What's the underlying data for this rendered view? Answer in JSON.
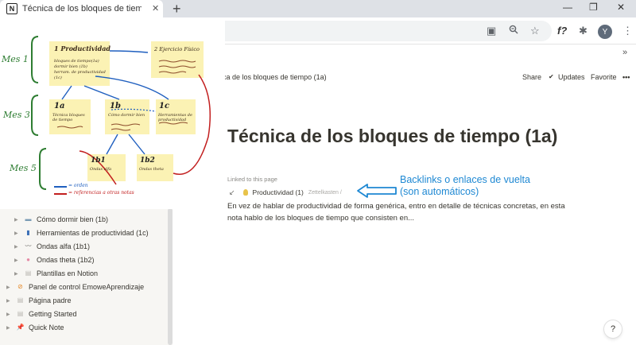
{
  "browser": {
    "tab_favicon": "N",
    "tab_title": "Técnica de los bloques de tiempo (1a)",
    "tab_close_icon": "close-icon",
    "new_tab": "+",
    "window_min": "—",
    "window_max": "❐",
    "window_close": "✕",
    "toolbar_icons": {
      "translate": "▣",
      "zoom": "🔍",
      "star": "☆",
      "functions": "f?",
      "extensions": "✱",
      "menu": "⋮"
    },
    "profile_initial": "Y",
    "bookmarks_more": "»"
  },
  "notion": {
    "breadcrumb": "ca de los bloques de tiempo (1a)",
    "share": "Share",
    "updates": "Updates",
    "favorite": "Favorite",
    "more": "•••",
    "page_title": "Técnica de los bloques de tiempo (1a)",
    "linked_label": "Linked to this page",
    "backlink": {
      "arrow": "↙",
      "title": "Productividad (1)",
      "sub": "Zettelkasten /"
    },
    "body": "En vez de hablar de productividad de forma genérica, entro en detalle de técnicas concretas, en esta nota hablo de los bloques de tiempo que consisten en...",
    "callout_line1": "Backlinks o enlaces de vuelta",
    "callout_line2": "(son automáticos)",
    "help": "?"
  },
  "sidebar": {
    "items": [
      {
        "label": "Cómo dormir bien (1b)",
        "icon": "bed-icon",
        "color": "#7a9bb5"
      },
      {
        "label": "Herramientas de productividad (1c)",
        "icon": "phone-icon",
        "color": "#3b6fb6"
      },
      {
        "label": "Ondas alfa (1b1)",
        "icon": "wave-icon",
        "color": "#6b6a66"
      },
      {
        "label": "Ondas theta (1b2)",
        "icon": "brain-icon",
        "color": "#e58aa5"
      },
      {
        "label": "Plantillas en Notion",
        "icon": "page-icon",
        "color": "#b9b7b1"
      },
      {
        "label": "Panel de control EmoweAprendizaje",
        "icon": "no-icon",
        "color": "#e58a2a"
      },
      {
        "label": "Página padre",
        "icon": "page-icon",
        "color": "#b9b7b1"
      },
      {
        "label": "Getting Started",
        "icon": "page-icon",
        "color": "#b9b7b1"
      },
      {
        "label": "Quick Note",
        "icon": "pin-icon",
        "color": "#d33b3b"
      }
    ]
  },
  "sketch": {
    "months": [
      "Mes 1",
      "Mes 3",
      "Mes 5"
    ],
    "notes": {
      "n1": {
        "title": "1 Productividad",
        "lines": [
          "bloques de tiempo(1a)",
          "dormir bien (1b)",
          "herram. de productividad (1c)"
        ]
      },
      "n2": {
        "title": "2 Ejercicio Físico"
      },
      "n1a": {
        "title": "1a",
        "sub": "Técnica bloques de tiempo"
      },
      "n1b": {
        "title": "1b",
        "sub": "Cómo dormir bien"
      },
      "n1c": {
        "title": "1c",
        "sub": "Herramientas de productividad"
      },
      "n1b1": {
        "title": "1b1",
        "sub": "Ondas alfa"
      },
      "n1b2": {
        "title": "1b2",
        "sub": "Ondas theta"
      }
    },
    "legend_order": "= orden",
    "legend_refs": "= referencias a otras notas",
    "colors": {
      "note": "#fbf2b4",
      "blue": "#1f5fbf",
      "red": "#c21f1f",
      "green": "#2e7d32"
    }
  }
}
